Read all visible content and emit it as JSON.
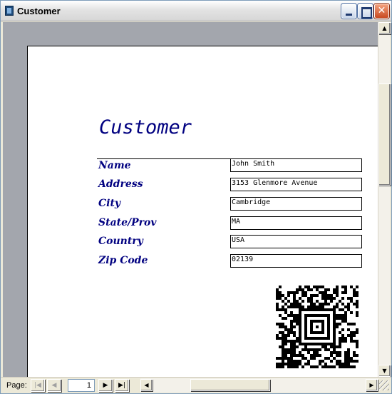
{
  "window": {
    "title": "Customer"
  },
  "titlebar_buttons": {
    "minimize_icon": "minimize-icon",
    "maximize_icon": "maximize-icon",
    "close_label": "✕"
  },
  "report": {
    "title": "Customer",
    "fields": [
      {
        "label": "Name",
        "value": "John Smith"
      },
      {
        "label": "Address",
        "value": "3153 Glenmore Avenue"
      },
      {
        "label": "City",
        "value": "Cambridge"
      },
      {
        "label": "State/Prov",
        "value": "MA"
      },
      {
        "label": "Country",
        "value": "USA"
      },
      {
        "label": "Zip Code",
        "value": "02139"
      }
    ],
    "barcode": "aztec-barcode"
  },
  "navigation": {
    "page_label": "Page:",
    "page_number": "1",
    "first_glyph": "|◀",
    "prev_glyph": "◀",
    "next_glyph": "▶",
    "last_glyph": "▶|"
  },
  "scrollbars": {
    "up_glyph": "▲",
    "down_glyph": "▼",
    "left_glyph": "◀",
    "right_glyph": "▶"
  },
  "colors": {
    "label_color": "#000080",
    "page_background": "#ffffff",
    "workspace_background": "#a3a6ad"
  }
}
